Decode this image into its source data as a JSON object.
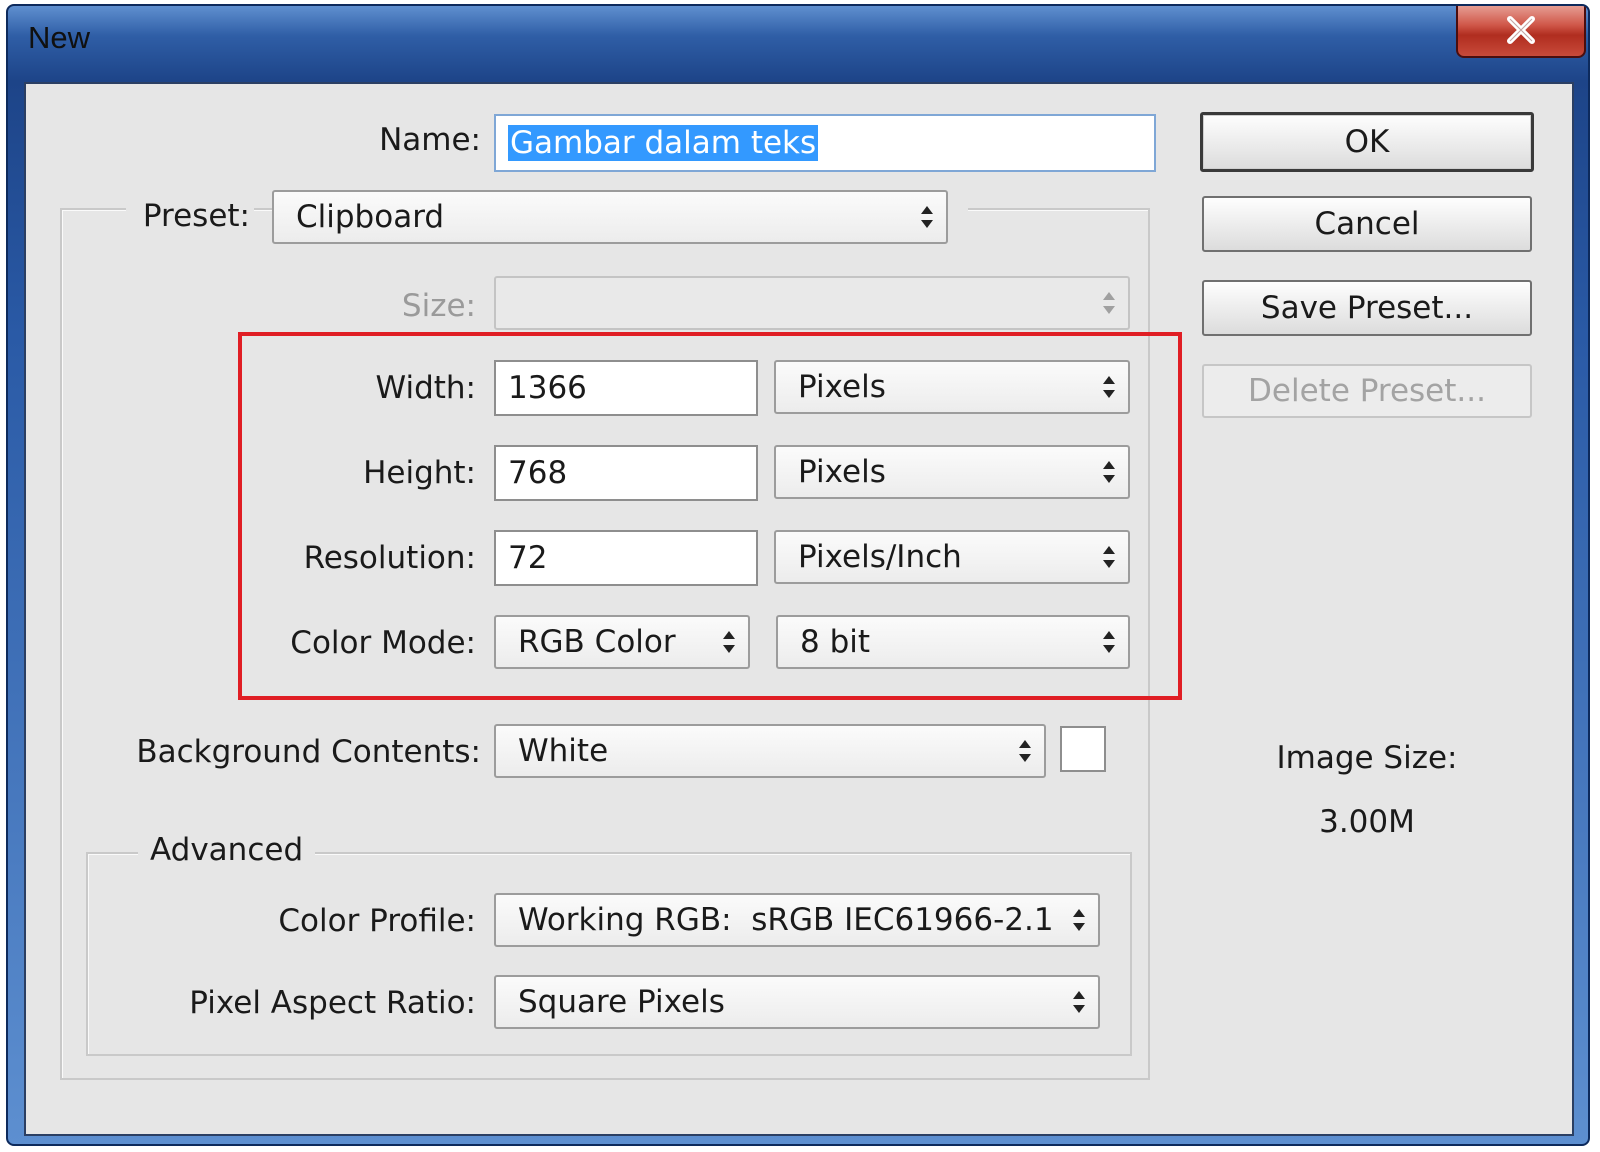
{
  "window": {
    "title": "New"
  },
  "form": {
    "name_label": "Name:",
    "name_value": "Gambar dalam teks",
    "preset_label": "Preset:",
    "preset_value": "Clipboard",
    "size_label": "Size:",
    "size_value": "",
    "width_label": "Width:",
    "width_value": "1366",
    "width_unit": "Pixels",
    "height_label": "Height:",
    "height_value": "768",
    "height_unit": "Pixels",
    "resolution_label": "Resolution:",
    "resolution_value": "72",
    "resolution_unit": "Pixels/Inch",
    "color_mode_label": "Color Mode:",
    "color_mode_value": "RGB Color",
    "bit_depth_value": "8 bit",
    "background_label": "Background Contents:",
    "background_value": "White",
    "background_swatch_color": "#ffffff"
  },
  "advanced": {
    "legend": "Advanced",
    "color_profile_label": "Color Profile:",
    "color_profile_value": "Working RGB:  sRGB IEC61966-2.1",
    "pixel_aspect_label": "Pixel Aspect Ratio:",
    "pixel_aspect_value": "Square Pixels"
  },
  "buttons": {
    "ok": "OK",
    "cancel": "Cancel",
    "save_preset": "Save Preset...",
    "delete_preset": "Delete Preset..."
  },
  "image_size": {
    "label": "Image Size:",
    "value": "3.00M"
  },
  "highlight": {
    "color": "#e01e24"
  },
  "icons": {
    "close": "close-icon",
    "dropdown": "updown-arrows-icon"
  }
}
